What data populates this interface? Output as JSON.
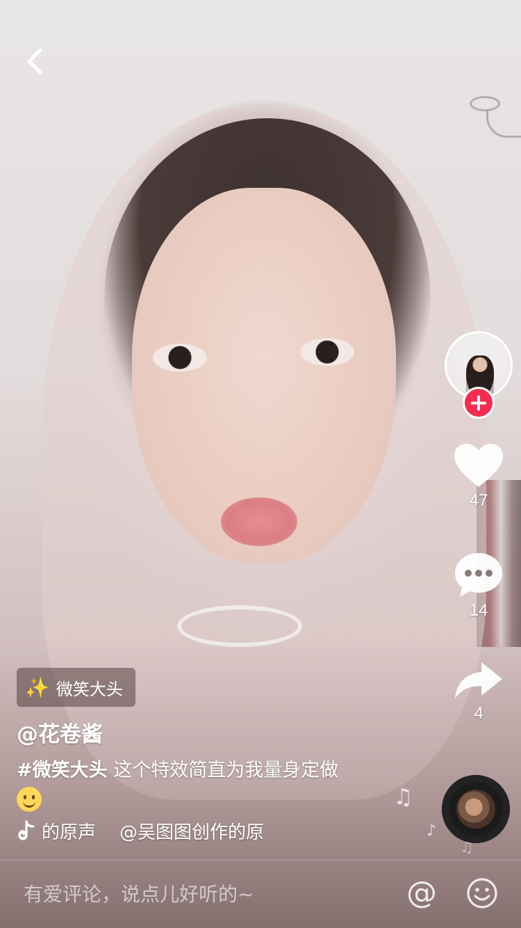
{
  "nav": {
    "back_icon": "chevron-left-icon"
  },
  "author": {
    "username": "@花卷酱",
    "avatar_icon": "user-avatar",
    "follow_symbol": "+"
  },
  "actions": {
    "like_count": "47",
    "comment_count": "14",
    "share_count": "4"
  },
  "effect": {
    "label": "微笑大头",
    "icon": "magic-wand-icon"
  },
  "caption": {
    "hashtag": "#微笑大头",
    "text": " 这个特效简直为我量身定做"
  },
  "music": {
    "segments": [
      "的原声",
      "@吴图图创作的原"
    ]
  },
  "comment_bar": {
    "placeholder": "有爱评论，说点儿好听的~",
    "at_symbol": "@"
  },
  "colors": {
    "follow_badge": "#f52c52",
    "effect_star": "#f5c540"
  }
}
